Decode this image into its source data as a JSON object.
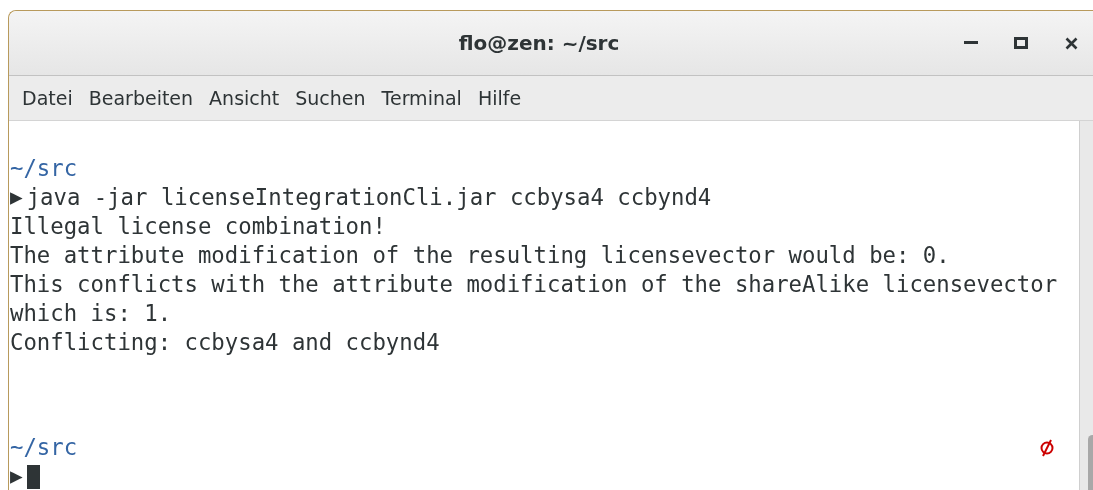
{
  "window": {
    "title": "flo@zen: ~/src"
  },
  "menu": [
    {
      "label": "Datei"
    },
    {
      "label": "Bearbeiten"
    },
    {
      "label": "Ansicht"
    },
    {
      "label": "Suchen"
    },
    {
      "label": "Terminal"
    },
    {
      "label": "Hilfe"
    }
  ],
  "terminal": {
    "prompt_symbol": "▶",
    "lines": [
      {
        "kind": "directory",
        "text": "~/src"
      },
      {
        "kind": "command",
        "text": "java -jar licenseIntegrationCli.jar ccbysa4 ccbynd4"
      },
      {
        "kind": "output",
        "text": "Illegal license combination!"
      },
      {
        "kind": "output",
        "text": "The attribute modification of the resulting licensevector would be: 0."
      },
      {
        "kind": "output",
        "text": "This conflicts with the attribute modification of the shareAlike licensevector"
      },
      {
        "kind": "output",
        "text": "which is: 1."
      },
      {
        "kind": "output",
        "text": "Conflicting: ccbysa4 and ccbynd4"
      }
    ],
    "current": {
      "directory": "~/src"
    }
  }
}
